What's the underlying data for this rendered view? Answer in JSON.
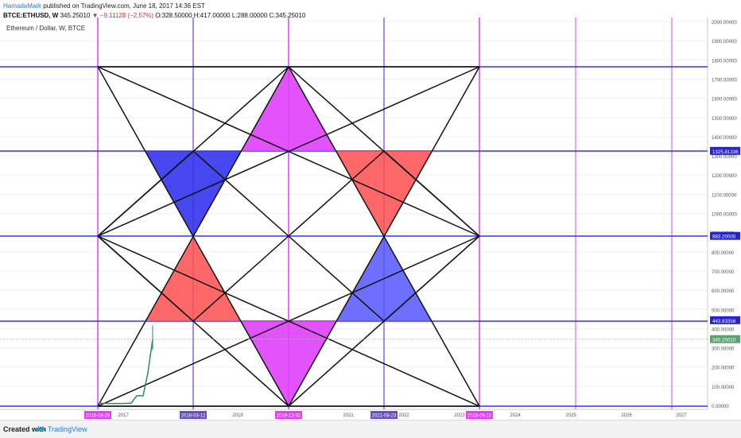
{
  "header": {
    "author": "HamadaMark",
    "published_text": "published on TradingView.com, June 18, 2017 14:36 EST",
    "symbol": "BTCE:ETHUSD, W",
    "last": "345.25010",
    "change": "▼ −9.11128 (−2.57%)",
    "ohlc": "O:328.50000 H:417.00000 L:288.00000 C:345.25010"
  },
  "legend": "Ethereum / Dollar, W, BTCE",
  "footer": {
    "created_with": "Created with",
    "brand": "TradingView"
  },
  "colors": {
    "magenta": "#e040fb",
    "blue": "#3333ff",
    "red": "#ff4d4d",
    "purple_line": "#6a3de8",
    "price": "#2e8b57"
  },
  "chart_data": {
    "type": "line",
    "ylim": [
      0,
      2000
    ],
    "y_tick_labels": [
      "0.00000",
      "100.00000",
      "200.00000",
      "300.00000",
      "400.00000",
      "500.00000",
      "600.00000",
      "700.00000",
      "800.00000",
      "900.00000",
      "1000.00000",
      "1100.00000",
      "1200.00000",
      "1300.00000",
      "1400.00000",
      "1500.00000",
      "1600.00000",
      "1700.00000",
      "1800.00000",
      "1900.00000",
      "2000.00000"
    ],
    "x_tick_labels": [
      "2017",
      "2019",
      "2021",
      "2022",
      "2023",
      "2024",
      "2025",
      "2026",
      "2027"
    ],
    "x_highlight_labels": [
      "2016-08-29",
      "2018-03-12",
      "2019-12-02",
      "2021-08-23",
      "2023-05-15"
    ],
    "price_levels": [
      {
        "label": "1325.81336",
        "value": 1325.81336
      },
      {
        "label": "883.20000",
        "value": 883.2
      },
      {
        "label": "443.83358",
        "value": 443.83358
      }
    ],
    "last_price_label": "345.25010",
    "series": [
      {
        "name": "ETHUSD",
        "x": [
          "2016-08",
          "2016-11",
          "2017-01",
          "2017-02",
          "2017-03",
          "2017-04",
          "2017-05",
          "2017-06"
        ],
        "values": [
          11,
          10,
          10,
          12,
          50,
          50,
          170,
          345
        ]
      }
    ]
  }
}
